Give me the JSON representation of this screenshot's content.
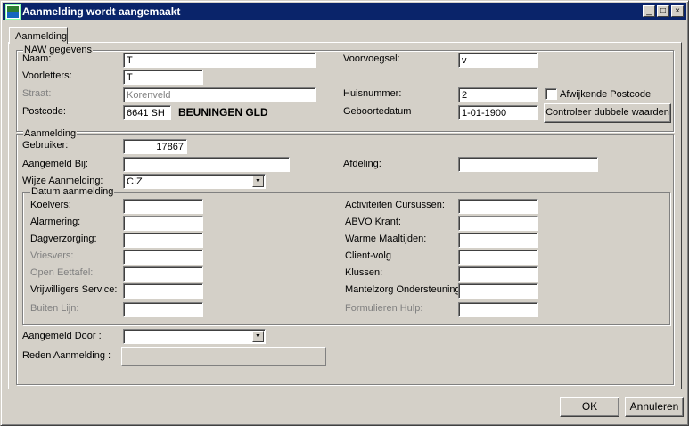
{
  "window": {
    "title": "Aanmelding wordt aangemaakt",
    "minimize_glyph": "_",
    "maximize_glyph": "□",
    "close_glyph": "×"
  },
  "tab": {
    "label": "Aanmelding"
  },
  "naw": {
    "group_title": "NAW gegevens",
    "naam": {
      "label": "Naam:",
      "value": "T"
    },
    "voorvoegsel": {
      "label": "Voorvoegsel:",
      "value": "v"
    },
    "voorletters": {
      "label": "Voorletters:",
      "value": "T"
    },
    "straat": {
      "label": "Straat:",
      "value": "Korenveld"
    },
    "huisnummer": {
      "label": "Huisnummer:",
      "value": "2"
    },
    "afwijkende_postcode": {
      "label": "Afwijkende Postcode",
      "checked": false
    },
    "postcode": {
      "label": "Postcode:",
      "value": "6641 SH",
      "plaats": "BEUNINGEN GLD"
    },
    "geboortedatum": {
      "label": "Geboortedatum",
      "value": "1-01-1900"
    },
    "controleer_button": "Controleer dubbele waarden"
  },
  "aanmelding": {
    "group_title": "Aanmelding",
    "gebruiker": {
      "label": "Gebruiker:",
      "value": "17867"
    },
    "aangemeld_bij": {
      "label": "Aangemeld Bij:",
      "value": ""
    },
    "afdeling": {
      "label": "Afdeling:",
      "value": ""
    },
    "wijze": {
      "label": "Wijze Aanmelding:",
      "value": "CIZ",
      "arrow": "▼"
    },
    "datum": {
      "group_title": "Datum aanmelding",
      "left": [
        {
          "label": "Koelvers:",
          "disabled": false
        },
        {
          "label": "Alarmering:",
          "disabled": false
        },
        {
          "label": "Dagverzorging:",
          "disabled": false
        },
        {
          "label": "Vriesvers:",
          "disabled": true
        },
        {
          "label": "Open Eettafel:",
          "disabled": true
        },
        {
          "label": "Vrijwilligers Service:",
          "disabled": false
        },
        {
          "label": "Buiten Lijn:",
          "disabled": true
        }
      ],
      "right": [
        {
          "label": "Activiteiten Cursussen:",
          "disabled": false
        },
        {
          "label": "ABVO Krant:",
          "disabled": false
        },
        {
          "label": "Warme Maaltijden:",
          "disabled": false
        },
        {
          "label": "Client-volg",
          "disabled": false
        },
        {
          "label": "Klussen:",
          "disabled": false
        },
        {
          "label": "Mantelzorg Ondersteuning:",
          "disabled": false
        },
        {
          "label": "Formulieren Hulp:",
          "disabled": true
        }
      ]
    },
    "aangemeld_door": {
      "label": "Aangemeld Door :",
      "value": "",
      "arrow": "▼"
    },
    "reden": {
      "label": "Reden Aanmelding :",
      "value": ""
    }
  },
  "footer": {
    "ok": "OK",
    "annuleren": "Annuleren"
  }
}
